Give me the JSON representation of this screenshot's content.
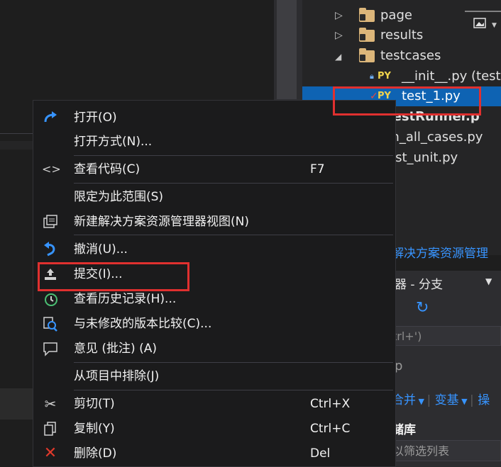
{
  "explorer": {
    "items": [
      {
        "label": "page",
        "kind": "folder",
        "expanded": false
      },
      {
        "label": "results",
        "kind": "folder",
        "expanded": false
      },
      {
        "label": "testcases",
        "kind": "folder",
        "expanded": true
      },
      {
        "label": "__init__.py (testc",
        "kind": "py-locked"
      },
      {
        "label": "test_1.py",
        "kind": "py-modified",
        "selected": true
      },
      {
        "label": "HTMLTestRunner.p",
        "kind": "py"
      },
      {
        "label": "un_all_cases.py",
        "kind": "py"
      },
      {
        "label": "est_unit.py",
        "kind": "py"
      }
    ],
    "py_badge": "PY",
    "footer_link": "解决方案资源管理"
  },
  "team": {
    "title": "器 - 分支",
    "search_placeholder": "trl+')",
    "partial_text": "p",
    "links": [
      "合并",
      "变基",
      "操"
    ],
    "repo_heading": "储库",
    "filter_placeholder": "以筛选列表"
  },
  "menu": {
    "items": [
      {
        "label": "打开(O)",
        "shortcut": "",
        "icon": "open-arrow-icon"
      },
      {
        "label": "打开方式(N)...",
        "shortcut": "",
        "icon": ""
      },
      {
        "label": "查看代码(C)",
        "shortcut": "F7",
        "icon": "code-icon"
      },
      {
        "label": "限定为此范围(S)",
        "shortcut": "",
        "icon": ""
      },
      {
        "label": "新建解决方案资源管理器视图(N)",
        "shortcut": "",
        "icon": "new-view-icon"
      },
      {
        "label": "撤消(U)...",
        "shortcut": "",
        "icon": "undo-icon"
      },
      {
        "label": "提交(I)...",
        "shortcut": "",
        "icon": "commit-upload-icon"
      },
      {
        "label": "查看历史记录(H)...",
        "shortcut": "",
        "icon": "history-icon"
      },
      {
        "label": "与未修改的版本比较(C)...",
        "shortcut": "",
        "icon": "compare-icon"
      },
      {
        "label": "意见 (批注) (A)",
        "shortcut": "",
        "icon": "comment-icon"
      },
      {
        "label": "从项目中排除(J)",
        "shortcut": "",
        "icon": ""
      },
      {
        "label": "剪切(T)",
        "shortcut": "Ctrl+X",
        "icon": "scissors-icon"
      },
      {
        "label": "复制(Y)",
        "shortcut": "Ctrl+C",
        "icon": "copy-icon"
      },
      {
        "label": "删除(D)",
        "shortcut": "Del",
        "icon": "delete-x-icon"
      }
    ]
  },
  "colors": {
    "accent_blue": "#3794ff",
    "selection": "#0e63b3",
    "highlight_red": "#e0302f",
    "delete_red": "#e0392b"
  }
}
